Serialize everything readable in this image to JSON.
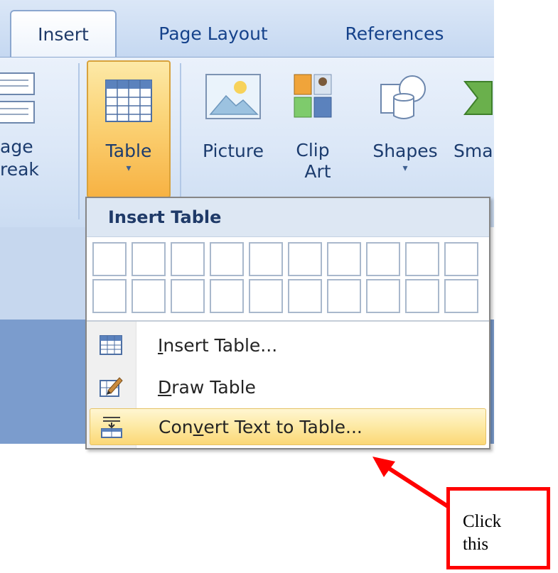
{
  "ribbon": {
    "tabs": [
      {
        "label": "Insert",
        "active": true
      },
      {
        "label": "Page Layout",
        "active": false
      },
      {
        "label": "References",
        "active": false
      }
    ],
    "page_break": {
      "line1": "age",
      "line2": "reak"
    },
    "table_button": {
      "label": "Table",
      "caret": "▾"
    },
    "picture_button": {
      "label": "Picture"
    },
    "clip_art_button": {
      "line1": "Clip",
      "line2": "Art"
    },
    "shapes_button": {
      "label": "Shapes",
      "caret": "▾"
    },
    "smartart_button": {
      "label": "Sma"
    }
  },
  "dropdown": {
    "header": "Insert Table",
    "grid": {
      "columns": 10,
      "rows": 2
    },
    "items": [
      {
        "pre": "",
        "accel": "I",
        "post": "nsert Table...",
        "icon": "insert-table-icon"
      },
      {
        "pre": "",
        "accel": "D",
        "post": "raw Table",
        "icon": "draw-table-icon"
      },
      {
        "pre": "Con",
        "accel": "v",
        "post": "ert Text to Table...",
        "icon": "convert-text-icon",
        "highlighted": true
      }
    ]
  },
  "annotation": {
    "line1": "Click",
    "line2": "this",
    "color": "#ff0000"
  },
  "colors": {
    "ribbon": "#dbe7f7",
    "highlight": "#fbd776",
    "accent": "#15428b"
  }
}
